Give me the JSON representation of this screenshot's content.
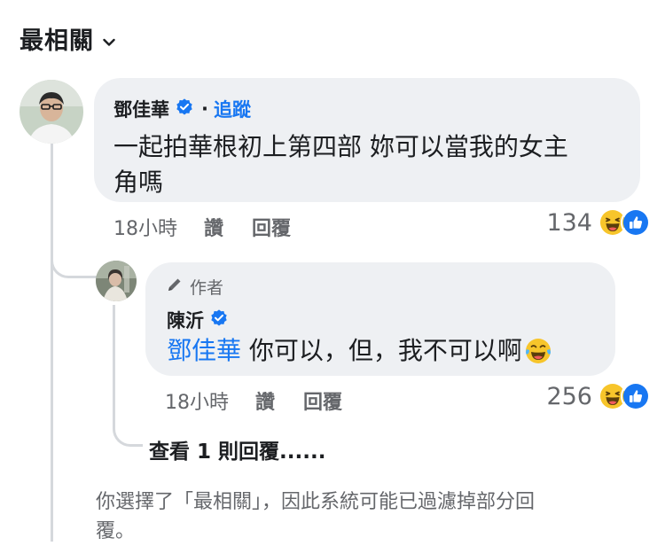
{
  "sort": {
    "label": "最相關",
    "icon": "chevron-down-icon"
  },
  "comment": {
    "author": "鄧佳華",
    "verified_icon": "verified-badge-icon",
    "separator": "·",
    "follow_label": "追蹤",
    "text_line1": "一起拍華根初上第四部 妳可以當我的女主",
    "text_line2": "角嗎",
    "time": "18小時",
    "like_label": "讚",
    "reply_label": "回覆",
    "reaction_count": "134",
    "reaction_icons": [
      "haha-icon",
      "like-icon"
    ]
  },
  "reply": {
    "author_tag": "作者",
    "author_tag_icon": "pen-icon",
    "author": "陳沂",
    "verified_icon": "verified-badge-icon",
    "mention": "鄧佳華",
    "text": " 你可以，但，我不可以啊",
    "emoji": "tears-of-joy-emoji",
    "time": "18小時",
    "like_label": "讚",
    "reply_label": "回覆",
    "reaction_count": "256",
    "reaction_icons": [
      "haha-icon",
      "like-icon"
    ]
  },
  "view_more": "查看 1 則回覆......",
  "notice": {
    "line1": "你選擇了「最相關」，因此系統可能已過濾掉部分回",
    "line2": "覆。"
  },
  "colors": {
    "accent": "#1877f2",
    "bubble": "#eef0f3",
    "secondary_text": "#65676b",
    "thread_line": "#d5d8dc"
  }
}
